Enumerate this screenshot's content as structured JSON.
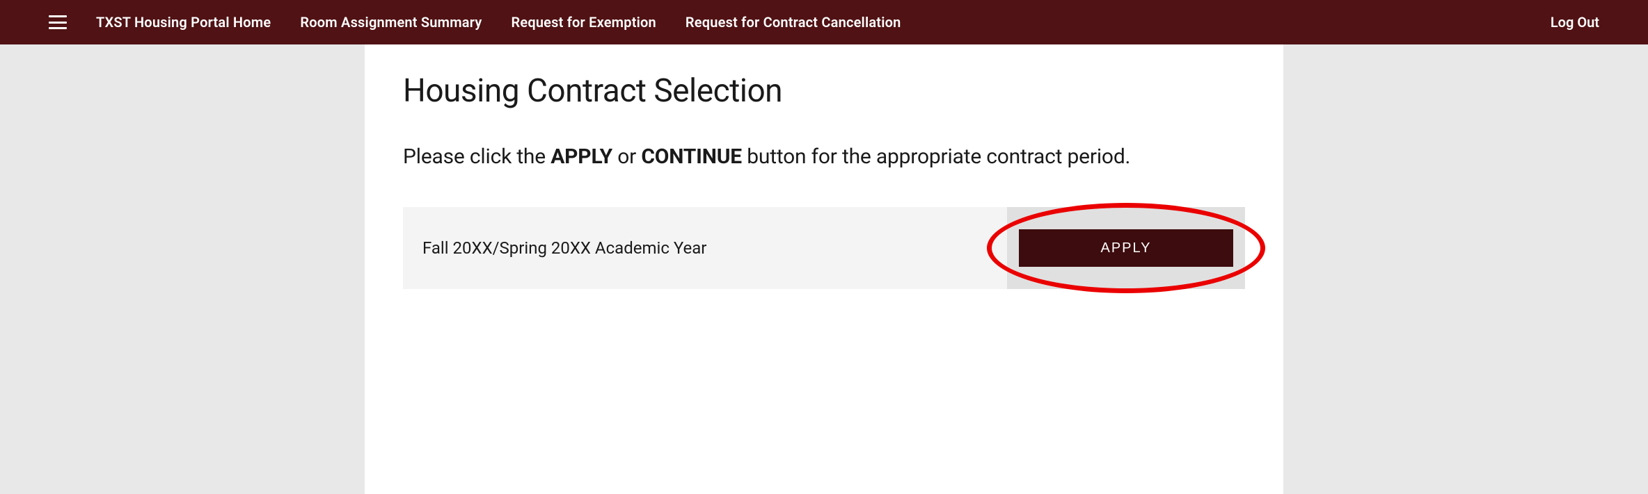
{
  "nav": {
    "items": [
      "TXST Housing Portal Home",
      "Room Assignment Summary",
      "Request for Exemption",
      "Request for Contract Cancellation"
    ],
    "logout": "Log Out"
  },
  "page": {
    "title": "Housing Contract Selection",
    "instruction_prefix": "Please click the ",
    "instruction_apply": "APPLY",
    "instruction_or": " or ",
    "instruction_continue": "CONTINUE",
    "instruction_suffix": " button for the appropriate contract period."
  },
  "contract": {
    "period_label": "Fall 20XX/Spring 20XX Academic Year",
    "apply_label": "APPLY"
  }
}
